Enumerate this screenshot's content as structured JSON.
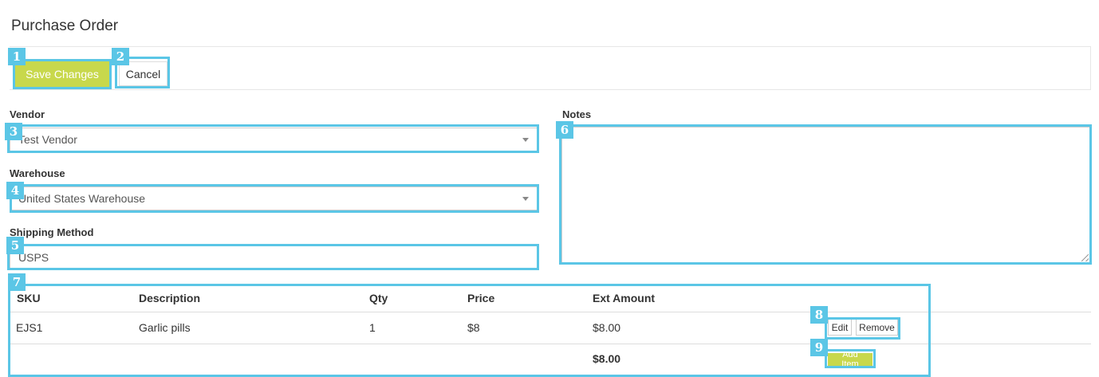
{
  "page": {
    "title": "Purchase Order"
  },
  "toolbar": {
    "save_label": "Save Changes",
    "cancel_label": "Cancel"
  },
  "form": {
    "vendor": {
      "label": "Vendor",
      "value": "Test Vendor"
    },
    "warehouse": {
      "label": "Warehouse",
      "value": "United States Warehouse"
    },
    "shipping": {
      "label": "Shipping Method",
      "value": "USPS"
    },
    "notes": {
      "label": "Notes",
      "value": ""
    }
  },
  "items_table": {
    "headers": {
      "sku": "SKU",
      "description": "Description",
      "qty": "Qty",
      "price": "Price",
      "ext_amount": "Ext Amount"
    },
    "rows": [
      {
        "sku": "EJS1",
        "description": "Garlic pills",
        "qty": "1",
        "price": "$8",
        "ext_amount": "$8.00"
      }
    ],
    "total": "$8.00",
    "edit_label": "Edit",
    "remove_label": "Remove",
    "add_item_label": "Add Item"
  },
  "annotations": [
    "1",
    "2",
    "3",
    "4",
    "5",
    "6",
    "7",
    "8",
    "9"
  ],
  "colors": {
    "accent": "#c8d84c",
    "highlight": "#5bc6e6"
  }
}
